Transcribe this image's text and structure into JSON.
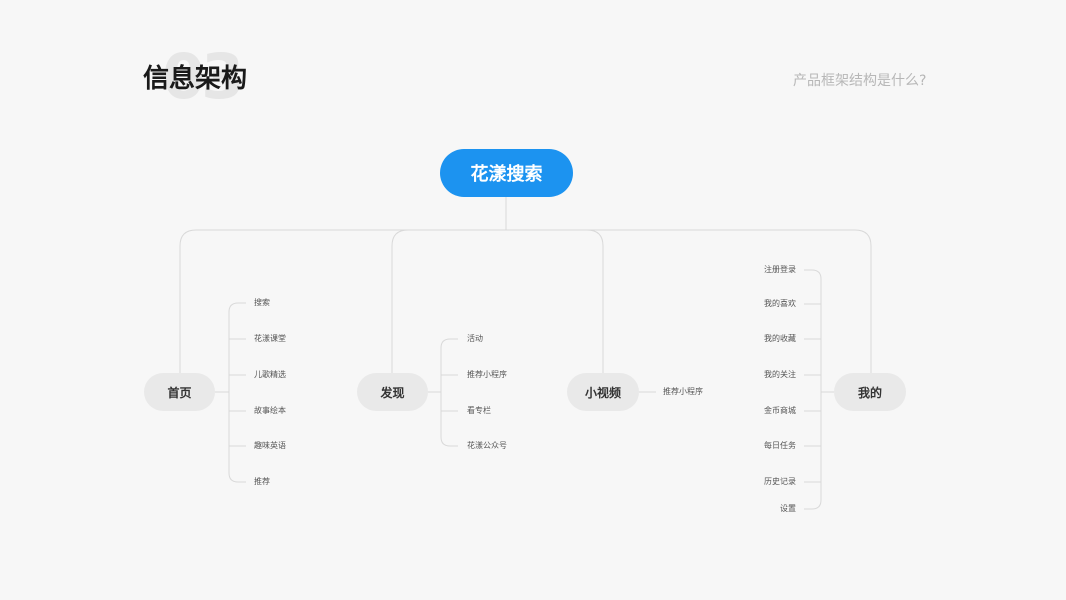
{
  "header": {
    "number": "03",
    "title": "信息架构",
    "subtitle": "产品框架结构是什么?"
  },
  "root": {
    "label": "花漾搜索"
  },
  "branches": {
    "home": {
      "label": "首页",
      "items": [
        "搜索",
        "花漾课堂",
        "儿歌精选",
        "故事绘本",
        "趣味英语",
        "推荐"
      ]
    },
    "discover": {
      "label": "发现",
      "items": [
        "活动",
        "推荐小程序",
        "看专栏",
        "花漾公众号"
      ]
    },
    "video": {
      "label": "小视频",
      "items": [
        "推荐小程序"
      ]
    },
    "mine": {
      "label": "我的",
      "items": [
        "注册登录",
        "我的喜欢",
        "我的收藏",
        "我的关注",
        "金币商城",
        "每日任务",
        "历史记录",
        "设置"
      ]
    }
  },
  "colors": {
    "accent": "#1c93f0",
    "node_bg": "#e9e9e9",
    "line": "#d9d9d9"
  }
}
